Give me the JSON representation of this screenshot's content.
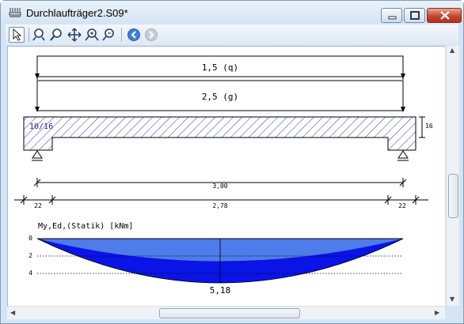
{
  "window": {
    "title": "Durchlaufträger2.S09*"
  },
  "toolbar": {
    "buttons": [
      "select-arrow-icon",
      "zoom-window-icon",
      "zoom-icon",
      "pan-icon",
      "zoom-in-icon",
      "zoom-out-icon",
      "back-icon",
      "forward-icon"
    ]
  },
  "drawing": {
    "load_q": "1,5 (q)",
    "load_g": "2,5 (g)",
    "section": "10/16",
    "height_dim": "16",
    "span_total": "3,00",
    "support_left": "22",
    "span_inner": "2,78",
    "support_right": "22",
    "moment_title": "My,Ed,(Statik) [kNm]",
    "axis_ticks": [
      "0",
      "2",
      "4"
    ],
    "max_moment": "5,18"
  },
  "colors": {
    "hatch": "#1a1ab4",
    "moment_fill": "#0a14e6",
    "moment_light": "#5a8ee8",
    "title_bar": "#d4e3f3"
  }
}
